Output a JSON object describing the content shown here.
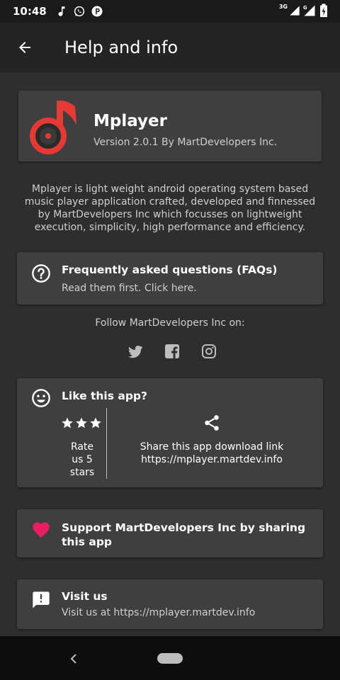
{
  "status": {
    "time": "10:48",
    "network_label": "3G"
  },
  "appbar": {
    "title": "Help and info"
  },
  "app": {
    "name": "Mplayer",
    "version": "Version 2.0.1 By MartDevelopers Inc."
  },
  "description": "Mplayer is light weight android operating system based music player application crafted, developed and finnessed by MartDevelopers Inc which focusses on lightweight execution, simplicity, high performance and efficiency.",
  "faq": {
    "title": "Frequently asked questions (FAQs)",
    "subtitle": "Read them first. Click here."
  },
  "follow": {
    "label": "Follow MartDevelopers Inc on:"
  },
  "like": {
    "title": "Like this app?",
    "rating": 3,
    "rate_text": "Rate us 5 stars",
    "share_text": "Share this app download link https://mplayer.martdev.info"
  },
  "support": {
    "title": "Support MartDevelopers Inc by sharing this app"
  },
  "visit": {
    "title": "Visit us",
    "subtitle": "Visit us at https://mplayer.martdev.info"
  },
  "colors": {
    "accent_red": "#e53935",
    "heart": "#e91e63",
    "card": "#3f3f3f",
    "background": "#2e2e2e"
  }
}
